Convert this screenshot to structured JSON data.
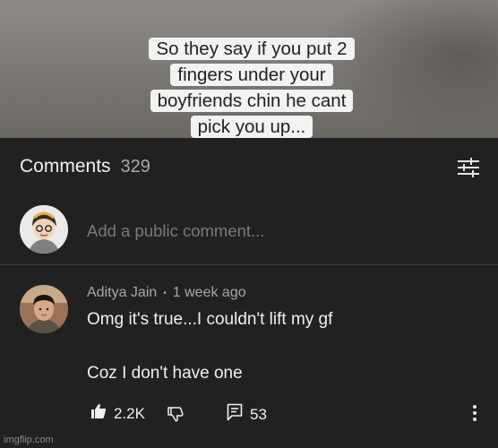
{
  "video": {
    "caption": "So they say if you put 2 fingers under your boyfriends chin he cant pick you up..."
  },
  "comments_header": {
    "title": "Comments",
    "count": "329",
    "filter_icon": "sliders-icon"
  },
  "composer": {
    "placeholder": "Add a public comment...",
    "avatar_icon": "user-avatar"
  },
  "comment": {
    "author": "Aditya Jain",
    "separator": "•",
    "time": "1 week ago",
    "text_line1": "Omg it's true...I couldn't lift my gf",
    "text_line2": "Coz I don't have one",
    "likes": "2.2K",
    "replies": "53",
    "icons": [
      "thumbs-up-icon",
      "thumbs-down-icon",
      "reply-icon",
      "more-vertical-icon"
    ]
  },
  "watermark": "imgflip.com",
  "colors": {
    "background": "#212121",
    "text_primary": "#f1f1f1",
    "text_secondary": "#aaaaaa"
  }
}
